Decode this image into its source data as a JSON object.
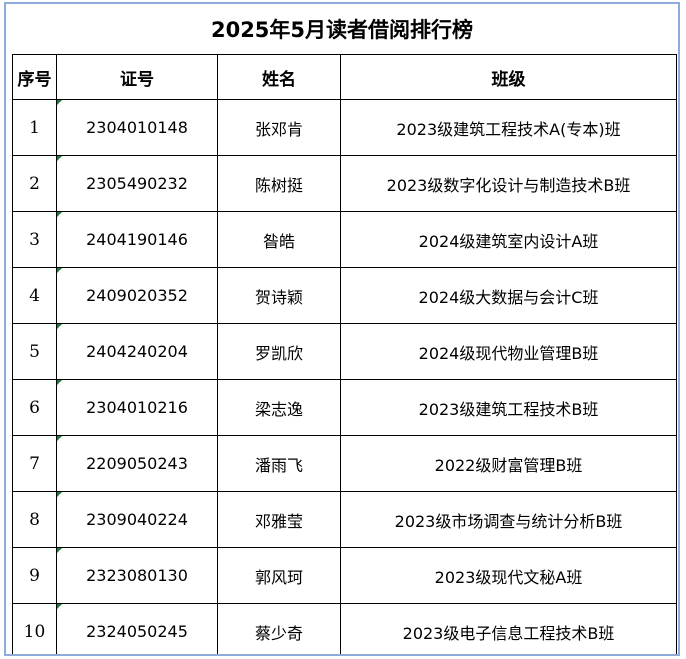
{
  "title": "2025年5月读者借阅排行榜",
  "columns": [
    "序号",
    "证号",
    "姓名",
    "班级"
  ],
  "rows": [
    {
      "rank": "1",
      "id": "2304010148",
      "name": "张邓肯",
      "class": "2023级建筑工程技术A(专本)班"
    },
    {
      "rank": "2",
      "id": "2305490232",
      "name": "陈树挺",
      "class": "2023级数字化设计与制造技术B班"
    },
    {
      "rank": "3",
      "id": "2404190146",
      "name": "昝皓",
      "class": "2024级建筑室内设计A班"
    },
    {
      "rank": "4",
      "id": "2409020352",
      "name": "贺诗颖",
      "class": "2024级大数据与会计C班"
    },
    {
      "rank": "5",
      "id": "2404240204",
      "name": "罗凯欣",
      "class": "2024级现代物业管理B班"
    },
    {
      "rank": "6",
      "id": "2304010216",
      "name": "梁志逸",
      "class": "2023级建筑工程技术B班"
    },
    {
      "rank": "7",
      "id": "2209050243",
      "name": "潘雨飞",
      "class": "2022级财富管理B班"
    },
    {
      "rank": "8",
      "id": "2309040224",
      "name": "邓雅莹",
      "class": "2023级市场调查与统计分析B班"
    },
    {
      "rank": "9",
      "id": "2323080130",
      "name": "郭风珂",
      "class": "2023级现代文秘A班"
    },
    {
      "rank": "10",
      "id": "2324050245",
      "name": "蔡少奇",
      "class": "2023级电子信息工程技术B班"
    }
  ],
  "colors": {
    "frame_border": "#8faadc",
    "cell_marker": "#1f7a3a"
  }
}
